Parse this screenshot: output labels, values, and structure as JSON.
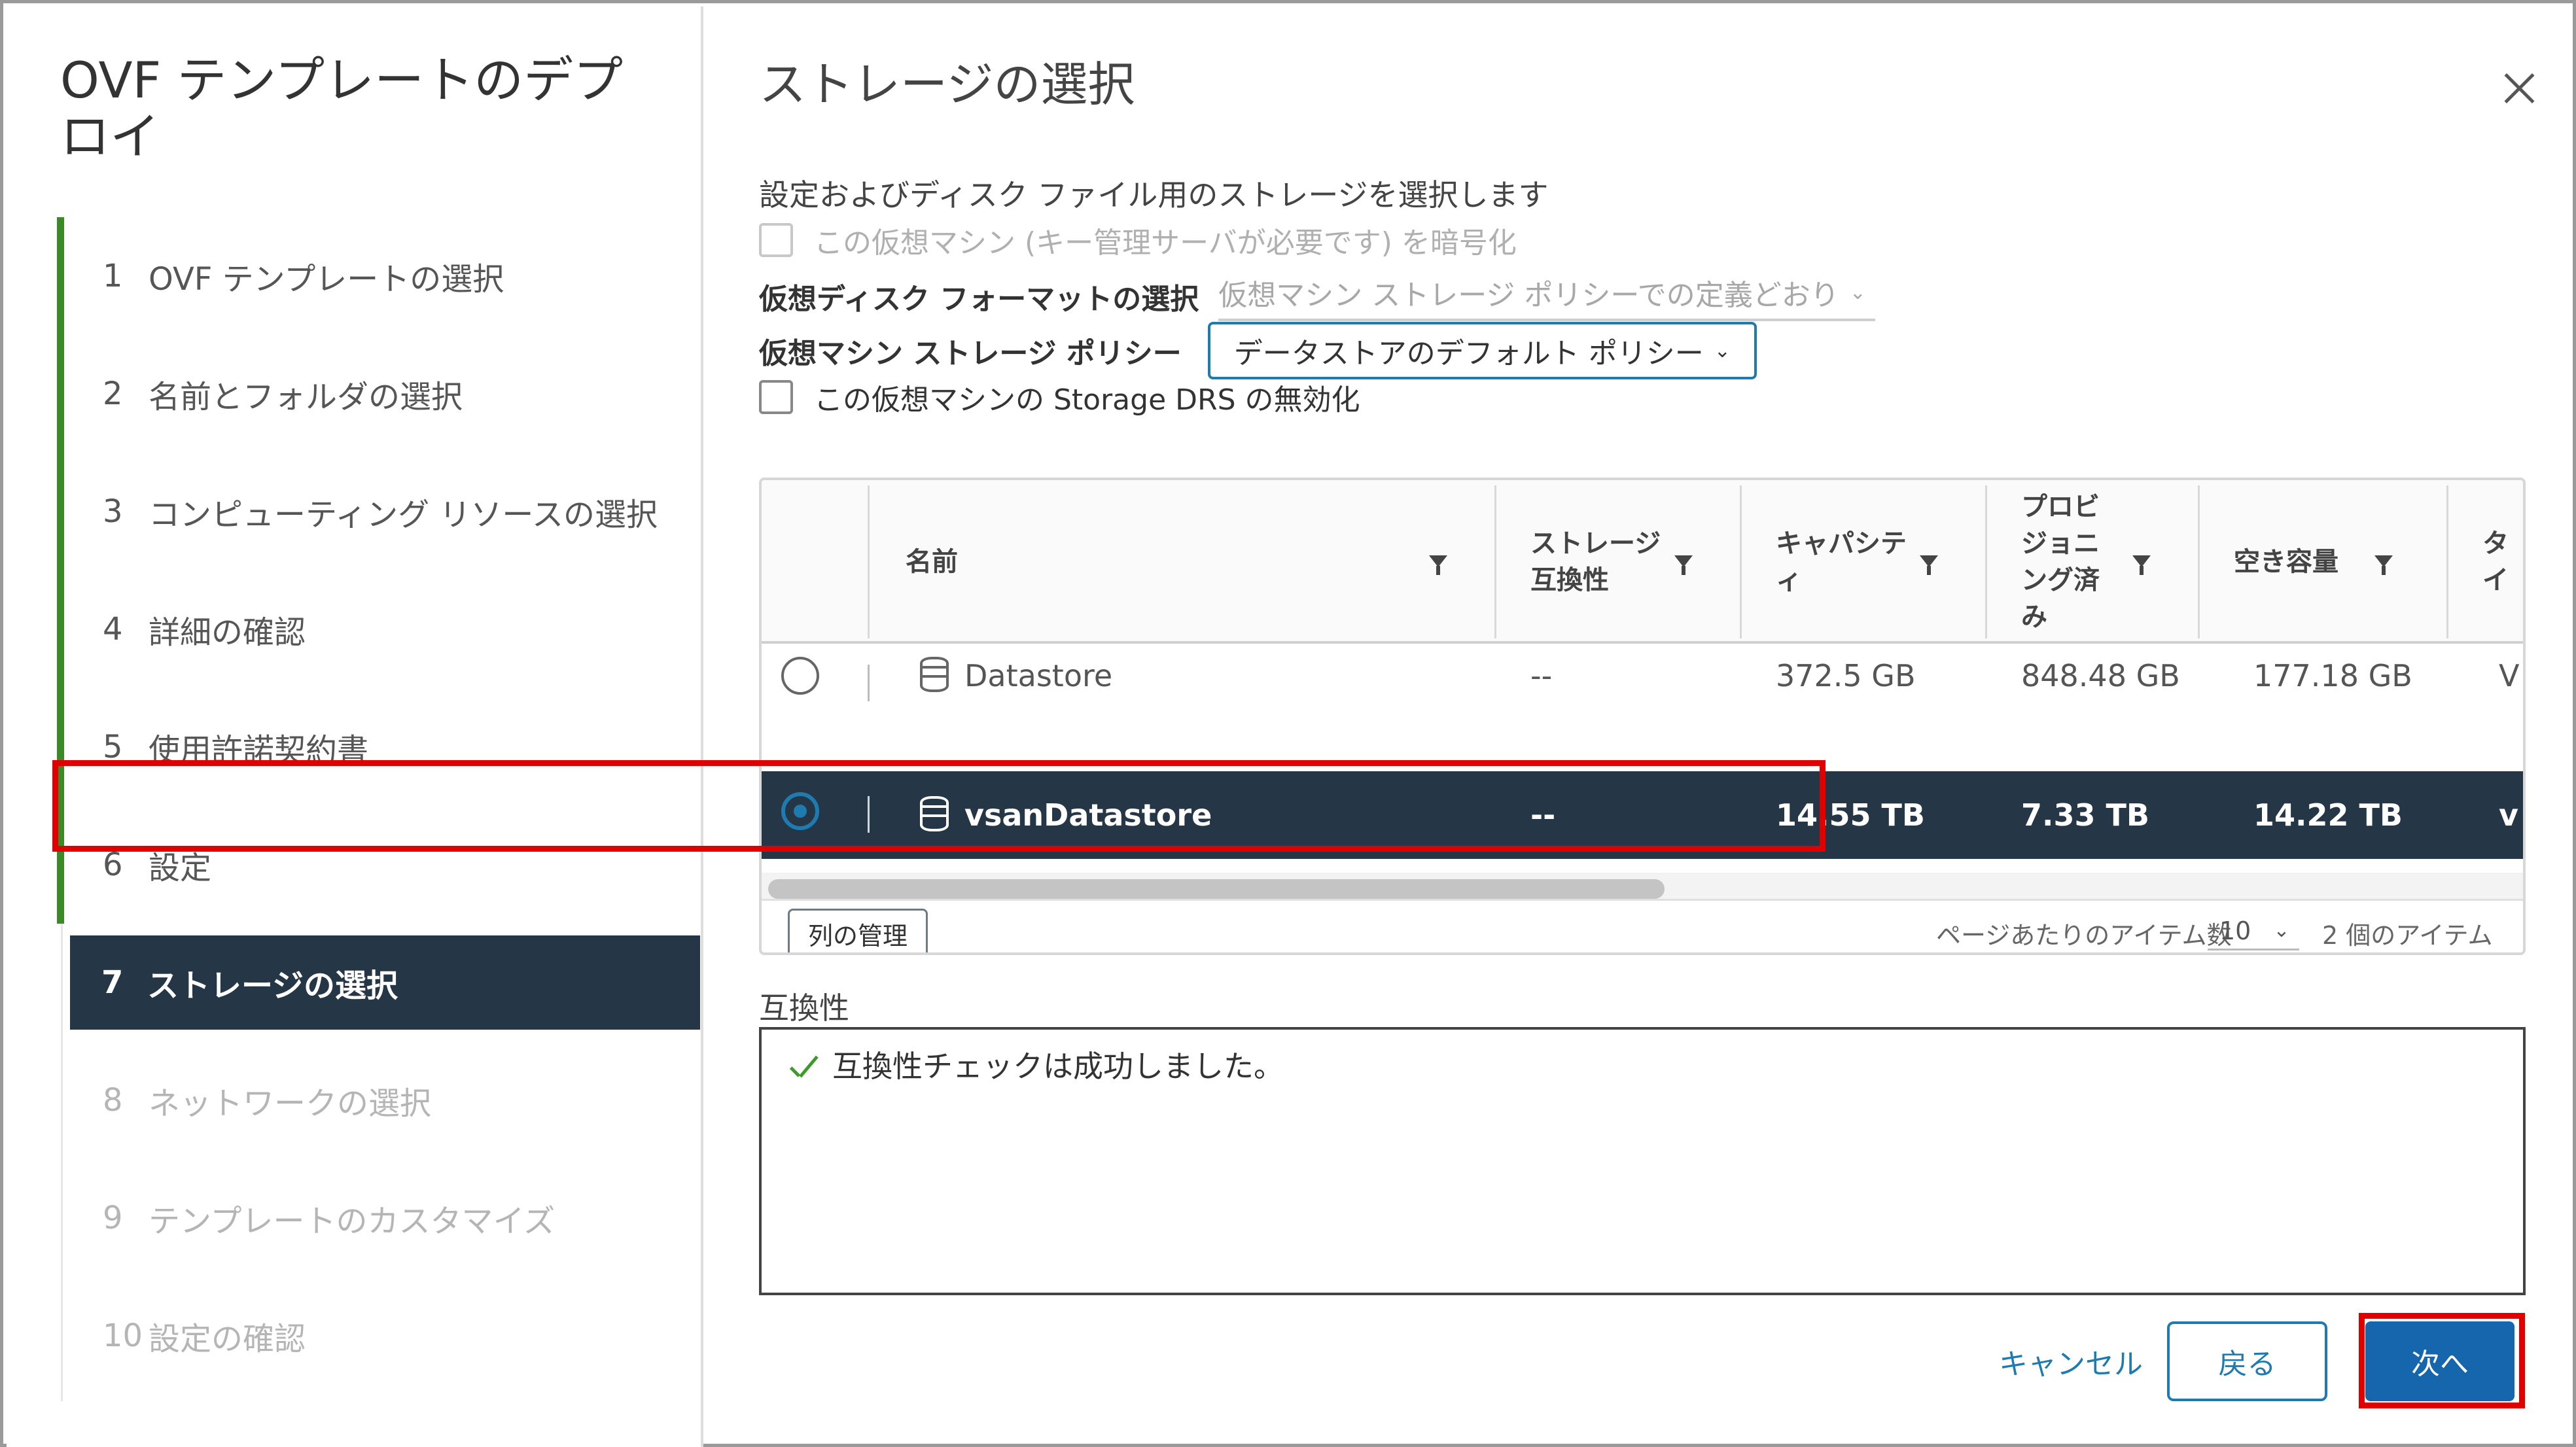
{
  "wizard": {
    "title": "OVF テンプレートのデプロイ",
    "steps": [
      {
        "num": "1",
        "label": "OVF テンプレートの選択"
      },
      {
        "num": "2",
        "label": "名前とフォルダの選択"
      },
      {
        "num": "3",
        "label": "コンピューティング リソースの選択"
      },
      {
        "num": "4",
        "label": "詳細の確認"
      },
      {
        "num": "5",
        "label": "使用許諾契約書"
      },
      {
        "num": "6",
        "label": "設定"
      },
      {
        "num": "7",
        "label": "ストレージの選択"
      },
      {
        "num": "8",
        "label": "ネットワークの選択"
      },
      {
        "num": "9",
        "label": "テンプレートのカスタマイズ"
      },
      {
        "num": "10",
        "label": "設定の確認"
      }
    ]
  },
  "page": {
    "title": "ストレージの選択",
    "subtitle": "設定およびディスク ファイル用のストレージを選択します",
    "encrypt_label": "この仮想マシン (キー管理サーバが必要です) を暗号化",
    "disk_format_label": "仮想ディスク フォーマットの選択",
    "disk_format_value": "仮想マシン ストレージ ポリシーでの定義どおり",
    "policy_label": "仮想マシン ストレージ ポリシー",
    "policy_value": "データストアのデフォルト ポリシー",
    "drs_label": "この仮想マシンの Storage DRS の無効化"
  },
  "grid": {
    "columns": {
      "name": "名前",
      "compat": "ストレージ\n互換性",
      "capacity": "キャパシテ\nィ",
      "provisioned": "プロビ\nジョニ\nング済\nみ",
      "free": "空き容量",
      "type": "タイ"
    },
    "rows": [
      {
        "name": "Datastore",
        "compat": "--",
        "capacity": "372.5 GB",
        "provisioned": "848.48 GB",
        "free": "177.18 GB",
        "type": "V"
      },
      {
        "name": "vsanDatastore",
        "compat": "--",
        "capacity": "14.55 TB",
        "provisioned": "7.33 TB",
        "free": "14.22 TB",
        "type": "v"
      }
    ],
    "manage_columns": "列の管理",
    "items_per_page_label": "ページあたりのアイテム数",
    "items_per_page": "10",
    "item_count": "2 個のアイテム"
  },
  "compatibility": {
    "label": "互換性",
    "message": "互換性チェックは成功しました。"
  },
  "buttons": {
    "cancel": "キャンセル",
    "back": "戻る",
    "next": "次へ"
  },
  "colors": {
    "accent": "#1e7bb0",
    "selected_row": "#253746",
    "progress": "#3a8a25",
    "highlight": "#e00000"
  }
}
